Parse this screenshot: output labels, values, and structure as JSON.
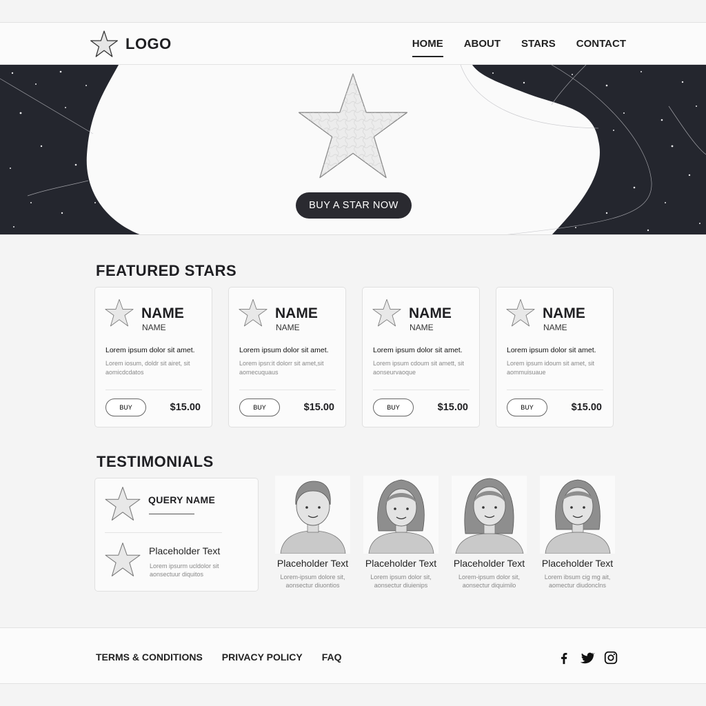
{
  "header": {
    "logo_text": "LOGO",
    "logo_icon": "star-icon",
    "nav": [
      {
        "label": "HOME",
        "active": true
      },
      {
        "label": "ABOUT",
        "active": false
      },
      {
        "label": "STARS",
        "active": false
      },
      {
        "label": "CONTACT",
        "active": false
      }
    ]
  },
  "hero": {
    "image": "star-icon",
    "cta_label": "BUY A STAR NOW"
  },
  "featured": {
    "title": "FEATURED STARS",
    "cards": [
      {
        "name": "NAME",
        "subtitle": "NAME",
        "lead": "Lorem ipsum dolor sit amet.",
        "desc": "Lorem iosum, doldr sit airet, sit aomicdcdatos",
        "buy_label": "BUY",
        "price": "$15.00"
      },
      {
        "name": "NAME",
        "subtitle": "NAME",
        "lead": "Lorem ipsum dolor sit amet.",
        "desc": "Lorem ipsn:it dolorr sit amet,sit aomecuquaus",
        "buy_label": "BUY",
        "price": "$15.00"
      },
      {
        "name": "NAME",
        "subtitle": "NAME",
        "lead": "Lorem ipsum dolor sit amet.",
        "desc": "Lorem ipsum cdoum sit amett, sit aonseurvaoque",
        "buy_label": "BUY",
        "price": "$15.00"
      },
      {
        "name": "NAME",
        "subtitle": "NAME",
        "lead": "Lorem ipsum dolor sit amet.",
        "desc": "Lorem ipsum idoum sit amet, sit aommuisuaue",
        "buy_label": "BUY",
        "price": "$15.00"
      }
    ]
  },
  "testimonials": {
    "title": "TESTIMONIALS",
    "query": {
      "name": "QUERY NAME",
      "item_title": "Placeholder Text",
      "item_desc": "Lorem ipsurm ucldolor sit aonsectuur diquitos"
    },
    "people": [
      {
        "title": "Placeholder Text",
        "desc": "Lorem-ipsum dolore sit, aonsectur diuontios"
      },
      {
        "title": "Placeholder Text",
        "desc": "Lorem ipsum dolor sit, aonsectur diuienips"
      },
      {
        "title": "Placeholder Text",
        "desc": "Lorem-ipsum dolor sit, aonsectur diquimilo"
      },
      {
        "title": "Placeholder Text",
        "desc": "Lorem ibsum cig mg ait, aomectur diudonclns"
      }
    ]
  },
  "footer": {
    "links": [
      "TERMS & CONDITIONS",
      "PRIVACY POLICY",
      "FAQ"
    ],
    "social_icons": [
      "facebook-icon",
      "twitter-icon",
      "instagram-icon"
    ]
  },
  "colors": {
    "dark": "#24262e",
    "background": "#f4f4f4",
    "card": "#fbfbfb"
  }
}
